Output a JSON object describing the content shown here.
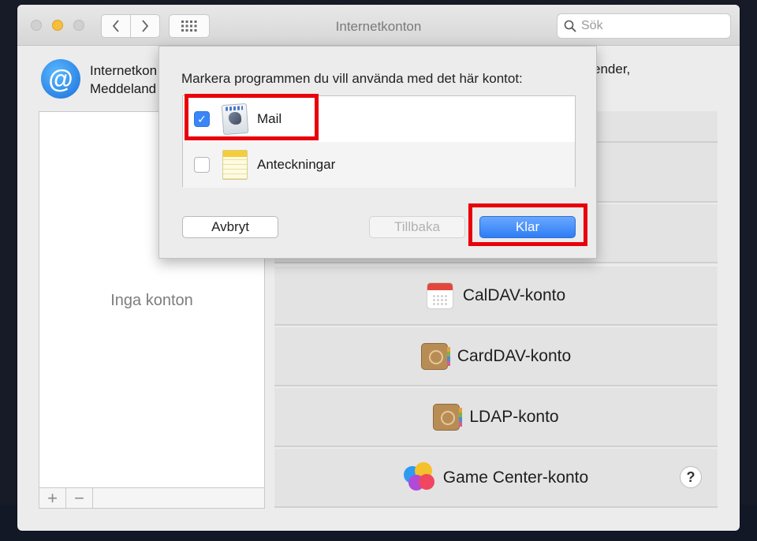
{
  "window": {
    "title": "Internetkonton",
    "search_placeholder": "Sök"
  },
  "header": {
    "text_line1": "Internetkon",
    "text_line2": "Meddeland",
    "text_right": "ender,"
  },
  "accounts_list": {
    "empty_text": "Inga konton",
    "add_button": "+",
    "remove_button": "−"
  },
  "providers": [
    {
      "label": "CalDAV-konto",
      "icon": "calendar-icon"
    },
    {
      "label": "CardDAV-konto",
      "icon": "contacts-book-icon"
    },
    {
      "label": "LDAP-konto",
      "icon": "contacts-book-icon"
    },
    {
      "label": "Game Center-konto",
      "icon": "game-center-icon"
    }
  ],
  "help_button": "?",
  "sheet": {
    "prompt": "Markera programmen du vill använda med det här kontot:",
    "apps": [
      {
        "label": "Mail",
        "checked": true,
        "icon": "mail-icon"
      },
      {
        "label": "Anteckningar",
        "checked": false,
        "icon": "notes-icon"
      }
    ],
    "cancel_label": "Avbryt",
    "back_label": "Tillbaka",
    "done_label": "Klar"
  },
  "highlight_color": "#e8000b",
  "accent_color": "#3b86f7"
}
